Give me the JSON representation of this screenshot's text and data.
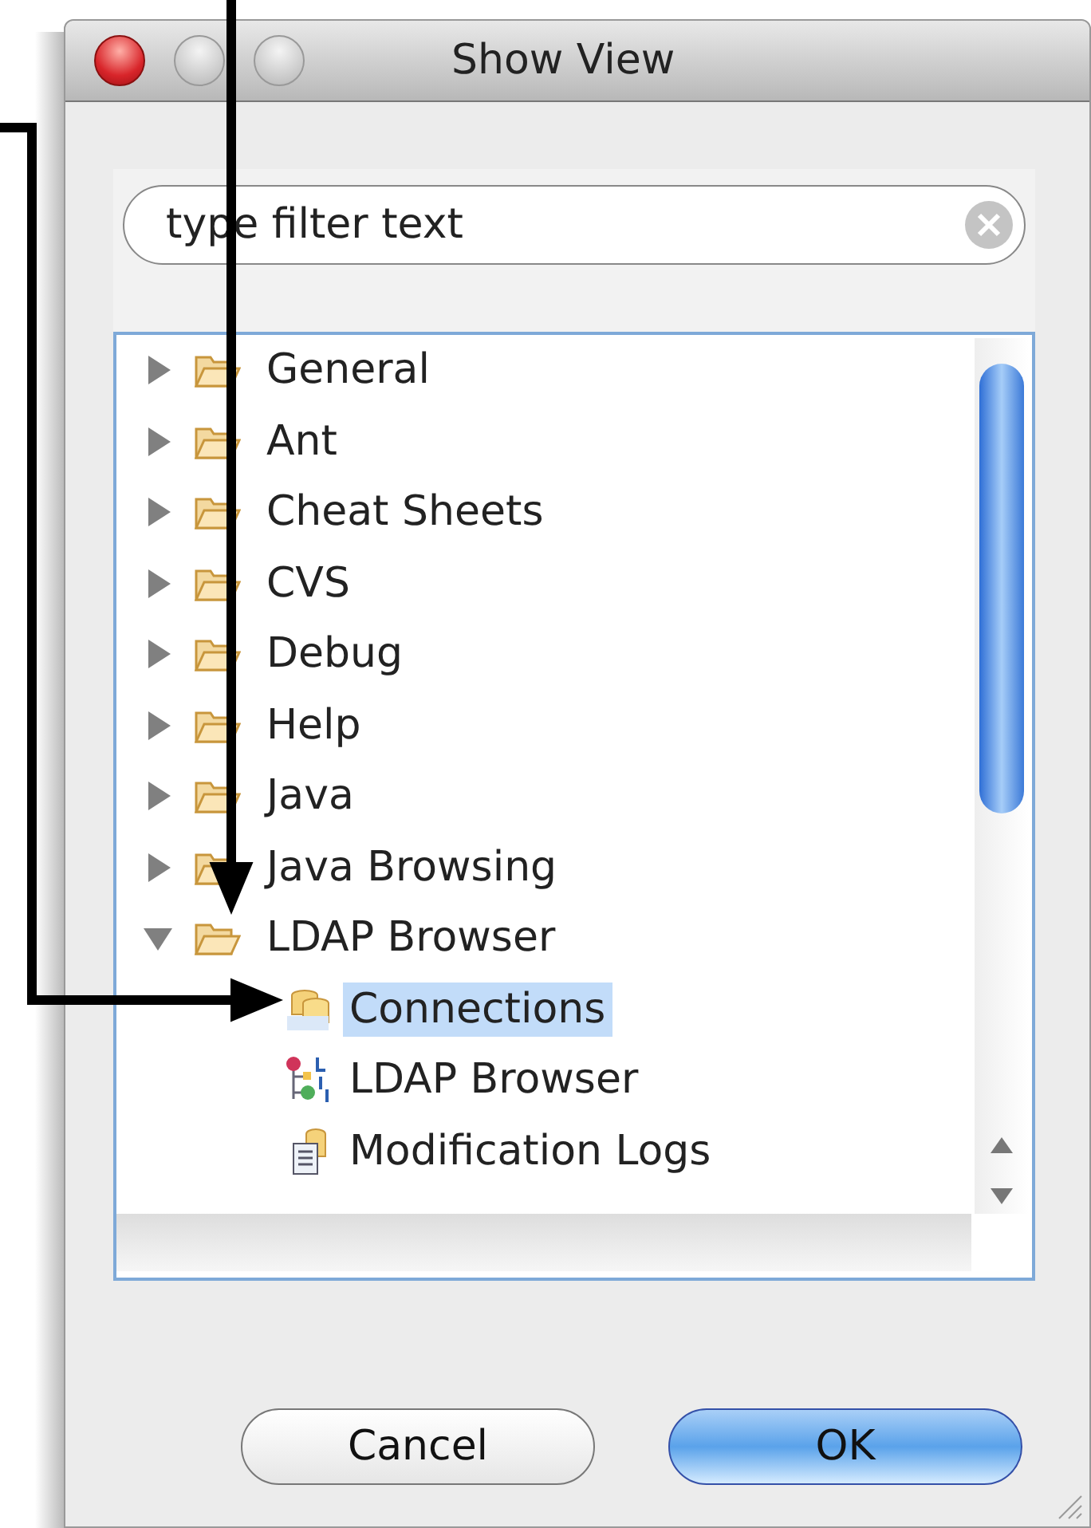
{
  "window": {
    "title": "Show View"
  },
  "filter": {
    "placeholder": "type filter text"
  },
  "tree": [
    {
      "label": "General",
      "expanded": false,
      "selected": false
    },
    {
      "label": "Ant",
      "expanded": false,
      "selected": false
    },
    {
      "label": "Cheat Sheets",
      "expanded": false,
      "selected": false
    },
    {
      "label": "CVS",
      "expanded": false,
      "selected": false
    },
    {
      "label": "Debug",
      "expanded": false,
      "selected": false
    },
    {
      "label": "Help",
      "expanded": false,
      "selected": false
    },
    {
      "label": "Java",
      "expanded": false,
      "selected": false
    },
    {
      "label": "Java Browsing",
      "expanded": false,
      "selected": false
    },
    {
      "label": "LDAP Browser",
      "expanded": true,
      "selected": false,
      "children": [
        {
          "label": "Connections",
          "kind": "connections",
          "selected": true
        },
        {
          "label": "LDAP Browser",
          "kind": "browser",
          "selected": false
        },
        {
          "label": "Modification Logs",
          "kind": "logs",
          "selected": false
        }
      ]
    }
  ],
  "buttons": [
    {
      "label": "Cancel",
      "default": false
    },
    {
      "label": "OK",
      "default": true
    }
  ]
}
